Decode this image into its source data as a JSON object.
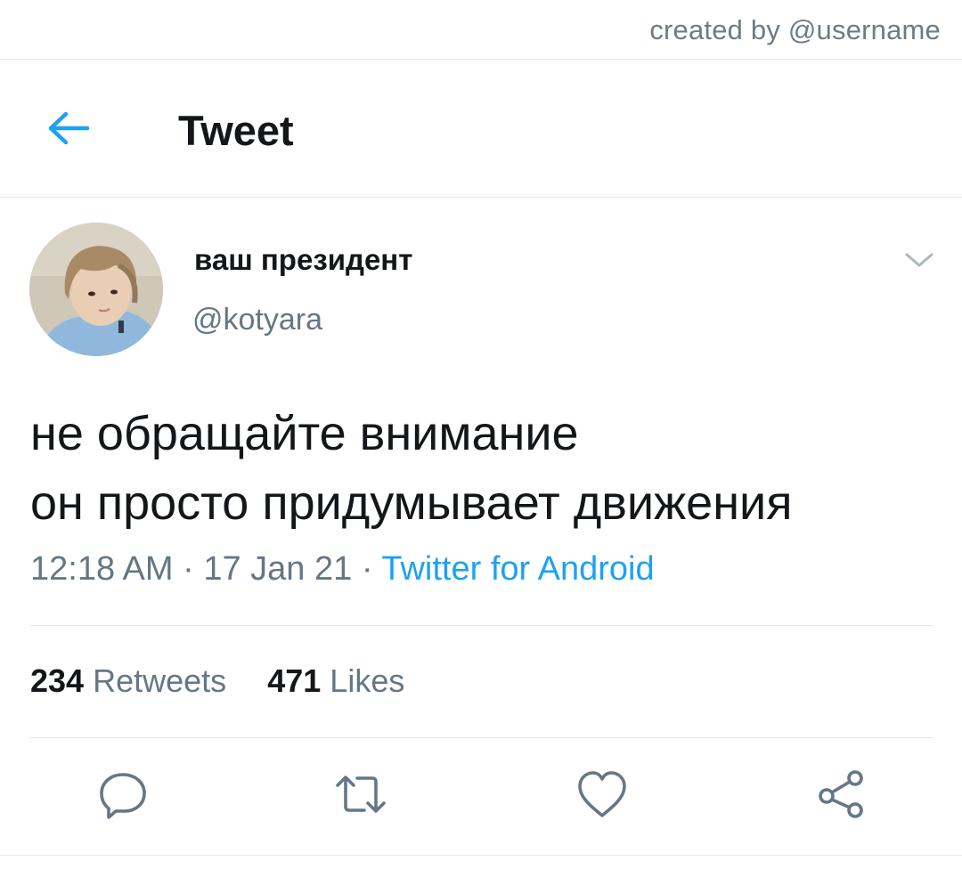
{
  "credit": {
    "text": "created by @username"
  },
  "header": {
    "back_icon": "arrow-left-icon",
    "title": "Tweet"
  },
  "tweet": {
    "author": {
      "display_name": "ваш президент",
      "handle": "@kotyara"
    },
    "text_lines": [
      "не обращайте внимание",
      "он просто придумывает движения"
    ],
    "time": "12:18 AM",
    "separator": "·",
    "date": "17 Jan 21",
    "source": "Twitter for Android"
  },
  "stats": {
    "retweets_count": "234",
    "retweets_label": "Retweets",
    "likes_count": "471",
    "likes_label": "Likes"
  },
  "actions": [
    {
      "icon": "reply-icon"
    },
    {
      "icon": "retweet-icon"
    },
    {
      "icon": "like-icon"
    },
    {
      "icon": "share-icon"
    }
  ],
  "colors": {
    "accent": "#1da1f2",
    "text_primary": "#14171a",
    "text_secondary": "#657786",
    "divider": "#e1e8ed"
  }
}
